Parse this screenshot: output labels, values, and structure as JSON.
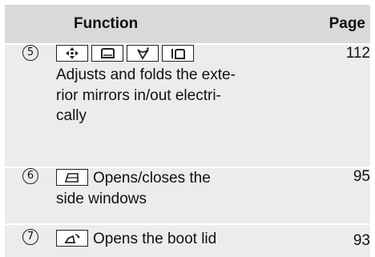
{
  "table": {
    "headers": {
      "number": "",
      "function": "Function",
      "page": "Page"
    },
    "rows": [
      {
        "number": "5",
        "keys": [
          "mirror-adjust-4way-icon",
          "left-mirror-icon",
          "right-mirror-icon",
          "mirror-fold-icon"
        ],
        "text_lines": [
          "Adjusts and folds the exte-",
          "rior mirrors in/out electri-",
          "cally"
        ],
        "page": "112"
      },
      {
        "number": "6",
        "keys": [
          "side-window-icon"
        ],
        "text_lines": [
          "Opens/closes the",
          "side windows"
        ],
        "page": "95"
      },
      {
        "number": "7",
        "keys": [
          "boot-lid-icon"
        ],
        "text_lines": [
          "Opens the boot lid"
        ],
        "page": "93"
      }
    ]
  }
}
